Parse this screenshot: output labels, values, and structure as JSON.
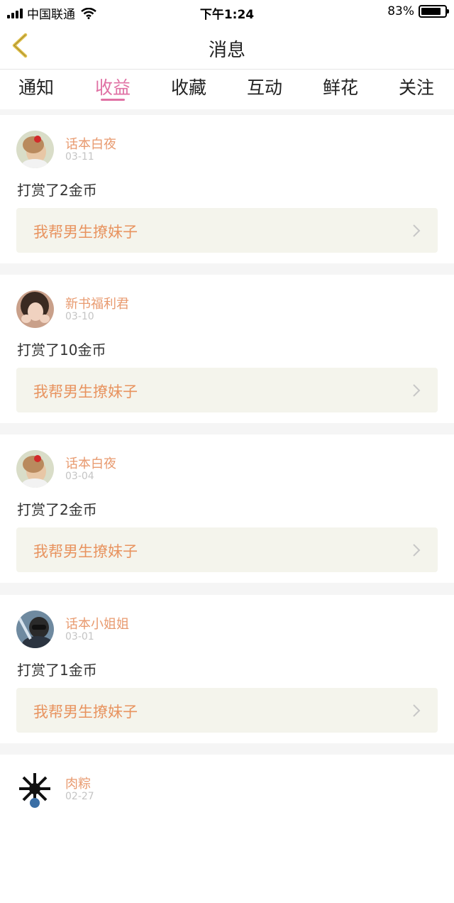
{
  "status_bar": {
    "carrier": "中国联通",
    "time": "下午1:24",
    "battery": "83%",
    "battery_level": 0.83,
    "icons": [
      "signal-icon",
      "wifi-icon",
      "battery-icon"
    ]
  },
  "nav": {
    "title": "消息",
    "back_icon": "chevron-left-icon",
    "accent_color": "#e0c04a"
  },
  "tabs": {
    "active_index": 1,
    "active_color": "#e071a4",
    "items": [
      {
        "label": "通知"
      },
      {
        "label": "收益"
      },
      {
        "label": "收藏"
      },
      {
        "label": "互动"
      },
      {
        "label": "鲜花"
      },
      {
        "label": "关注"
      }
    ]
  },
  "messages": [
    {
      "name": "话本白夜",
      "date": "03-11",
      "text": "打赏了2金币",
      "book": "我帮男生撩妹子"
    },
    {
      "name": "新书福利君",
      "date": "03-10",
      "text": "打赏了10金币",
      "book": "我帮男生撩妹子"
    },
    {
      "name": "话本白夜",
      "date": "03-04",
      "text": "打赏了2金币",
      "book": "我帮男生撩妹子"
    },
    {
      "name": "话本小姐姐",
      "date": "03-01",
      "text": "打赏了1金币",
      "book": "我帮男生撩妹子"
    },
    {
      "name": "肉粽",
      "date": "02-27",
      "text": "",
      "book": ""
    }
  ],
  "colors": {
    "username": "#e89a6f",
    "book_title": "#e8935f",
    "book_bg": "#f4f4ec"
  }
}
